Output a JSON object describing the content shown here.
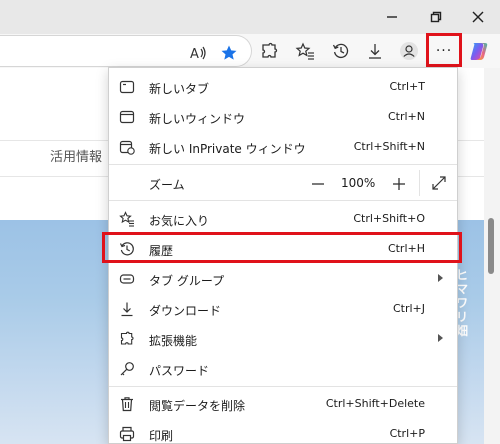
{
  "window": {
    "controls": [
      "minimize",
      "restore",
      "close"
    ]
  },
  "toolbar": {
    "icons": [
      "read-aloud-icon",
      "favorite-star-icon",
      "extensions-icon",
      "favorites-icon",
      "history-icon",
      "downloads-icon",
      "profile-icon",
      "more-icon",
      "copilot-icon"
    ],
    "more_label": "···"
  },
  "page": {
    "nav_text": "活用情報",
    "hero_text": "ヒマワリ畑"
  },
  "menu": {
    "items": [
      {
        "icon": "new-tab-icon",
        "label": "新しいタブ",
        "shortcut": "Ctrl+T"
      },
      {
        "icon": "new-window-icon",
        "label": "新しいウィンドウ",
        "shortcut": "Ctrl+N"
      },
      {
        "icon": "inprivate-window-icon",
        "label": "新しい InPrivate ウィンドウ",
        "shortcut": "Ctrl+Shift+N"
      },
      {
        "icon": "favorites-icon",
        "label": "お気に入り",
        "shortcut": "Ctrl+Shift+O"
      },
      {
        "icon": "history-icon",
        "label": "履歴",
        "shortcut": "Ctrl+H"
      },
      {
        "icon": "tab-groups-icon",
        "label": "タブ グループ",
        "shortcut": ""
      },
      {
        "icon": "downloads-icon",
        "label": "ダウンロード",
        "shortcut": "Ctrl+J"
      },
      {
        "icon": "extensions-icon",
        "label": "拡張機能",
        "shortcut": ""
      },
      {
        "icon": "key-icon",
        "label": "パスワード",
        "shortcut": ""
      },
      {
        "icon": "trash-icon",
        "label": "閲覧データを削除",
        "shortcut": "Ctrl+Shift+Delete"
      },
      {
        "icon": "print-icon",
        "label": "印刷",
        "shortcut": "Ctrl+P"
      }
    ],
    "zoom": {
      "label": "ズーム",
      "value": "100%",
      "minus": "—",
      "plus": "+"
    }
  },
  "colors": {
    "highlight": "#e0121a",
    "star": "#1a73e8"
  }
}
